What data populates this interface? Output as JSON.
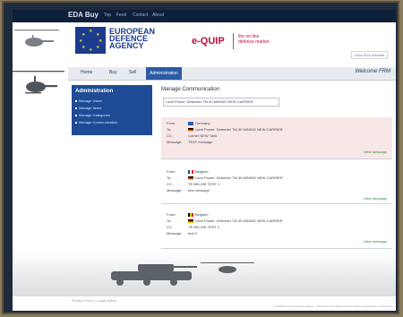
{
  "topbar": {
    "brand": "EDA Buy",
    "links": [
      "Top",
      "Feed",
      "Contact",
      "About"
    ]
  },
  "header": {
    "agency_lines": [
      "EUROPEAN",
      "DEFENCE",
      "AGENCY"
    ],
    "product": "e-QUIP",
    "tagline_lines": [
      "the on-line",
      "defence market"
    ],
    "account_link": "View EDA Website"
  },
  "nav": {
    "items": [
      "Home",
      "Buy",
      "Sell"
    ],
    "active": "Administration",
    "right_label": "Welcome FRM"
  },
  "sidebar": {
    "title": "Administration",
    "items": [
      "Manage Users",
      "Manage Items",
      "Manage Categories",
      "Manage Communication"
    ]
  },
  "main": {
    "title": "Manage Communication",
    "select_value": "Land Power: Defender TM-30 MINING NEW CARRIER"
  },
  "messages": [
    {
      "labels": [
        "From:",
        "To:",
        "CC:",
        "Message:"
      ],
      "values": [
        "Germany",
        "Land Power: Defender TM 30 MINING NEW CARRIER",
        "Carrier NEW Tank",
        "TEST message"
      ],
      "view": "View message",
      "highlight": true,
      "flag": "Sweden"
    },
    {
      "labels": [
        "From:",
        "To:",
        "CC:",
        "Message:"
      ],
      "values": [
        "Belgium",
        "Land Power: Defender TM 30 MINING NEW CARRIER",
        "TE BELGIE TEST 1",
        "test message"
      ],
      "view": "View message",
      "highlight": false,
      "flag": "France"
    },
    {
      "labels": [
        "From:",
        "To:",
        "CC:",
        "Message:"
      ],
      "values": [
        "Belgium",
        "Land Power: Defender TM 30 MINING NEW CARRIER",
        "TE BELGIE TEST 2",
        "test 2"
      ],
      "view": "View message",
      "highlight": false,
      "flag": "Belgium"
    }
  ],
  "footer": {
    "left": "Privacy Policy | Legal Notice",
    "right": "© 2008 European Defence Agency - Welcome to the EDA portal for defence equipment procurement"
  },
  "colors": {
    "brand_red": "#b3123e",
    "eda_blue": "#1b3c8e",
    "nav_active": "#2d5aa6",
    "view_link": "#2d8d3b"
  }
}
